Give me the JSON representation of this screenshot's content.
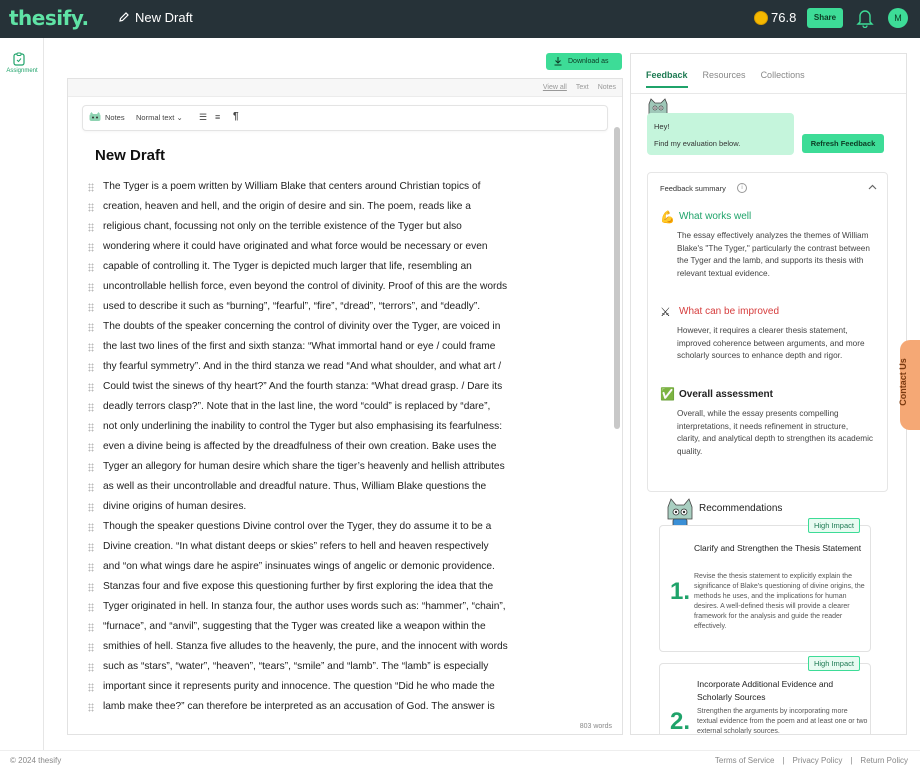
{
  "header": {
    "logo": "thesify.",
    "draft_title": "New Draft",
    "credits": "76.8",
    "share_label": "Share",
    "avatar_initial": "M"
  },
  "sidebar": {
    "assignment_label": "Assignment"
  },
  "editor": {
    "download_label": "Download as",
    "view_links": [
      "View all",
      "Text",
      "Notes"
    ],
    "toolbar": {
      "notes_label": "Notes",
      "style_label": "Normal text"
    },
    "doc_title": "New Draft",
    "lines": [
      "The Tyger is a poem written by William Blake that centers around Christian topics of",
      "creation, heaven and hell, and the origin of desire and sin. The poem, reads like a",
      "religious chant, focussing not only on the terrible existence of the Tyger but also",
      "wondering where it could have originated and what force would be necessary or even",
      "capable of controlling it. The Tyger is depicted much larger that life, resembling an",
      "uncontrollable hellish force, even beyond the control of divinity. Proof of this are the words",
      "used to describe it such as “burning”, “fearful”, “fire”, “dread”, “terrors”, and “deadly”.",
      "The doubts of the speaker concerning the control of divinity over the Tyger, are voiced in",
      "the last two lines of the first and sixth stanza: “What immortal hand or eye / could frame",
      "thy fearful symmetry”. And in the third stanza we read “And what shoulder, and what art /",
      "Could twist the sinews of thy heart?” And the fourth stanza: “What dread grasp. / Dare its",
      "deadly terrors clasp?”. Note that in the last line, the word “could” is replaced by “dare”,",
      "not only underlining the inability to control the Tyger but also emphasising its fearfulness:",
      "even a divine being is affected by the dreadfulness of their own creation. Bake uses the",
      "Tyger an allegory for human desire which share the tiger’s heavenly and hellish attributes",
      "as well as their uncontrollable and dreadful nature. Thus, William Blake questions the",
      "divine origins of human desires.",
      "Though the speaker questions Divine control over the Tyger, they do assume it to be a",
      "Divine creation. “In what distant deeps or skies” refers to hell and heaven respectively",
      "and “on what wings dare he aspire” insinuates wings of angelic or demonic providence.",
      "Stanzas four and five expose this questioning further by first exploring the idea that the",
      "Tyger originated in hell. In stanza four, the author uses words such as: “hammer”, “chain”,",
      "“furnace”, and “anvil”, suggesting that the Tyger was created like a weapon within the",
      "smithies of hell. Stanza five alludes to the heavenly, the pure, and the innocent with words",
      "such as “stars”, “water”, “heaven”, “tears”, “smile” and “lamb”. The “lamb” is especially",
      "important since it represents purity and innocence. The question “Did he who made the",
      "lamb make thee?” can therefore be interpreted as an accusation of God. The answer is"
    ],
    "word_count": "803 words"
  },
  "panel": {
    "tabs": [
      "Feedback",
      "Resources",
      "Collections"
    ],
    "greeting": "Hey!",
    "greeting_sub": "Find my evaluation below.",
    "refresh_label": "Refresh Feedback",
    "summary": {
      "heading": "Feedback summary",
      "sections": [
        {
          "icon": "💪",
          "title": "What works well",
          "color": "#1fa36a",
          "body": "The essay effectively analyzes the themes of William Blake's \"The Tyger,\" particularly the contrast between the Tyger and the lamb, and supports its thesis with relevant textual evidence."
        },
        {
          "icon": "⚔",
          "title": "What can be improved",
          "color": "#d63c3c",
          "body": "However, it requires a clearer thesis statement, improved coherence between arguments, and more scholarly sources to enhance depth and rigor."
        },
        {
          "icon": "✅",
          "title": "Overall assessment",
          "color": "#222222",
          "body": "Overall, while the essay presents compelling interpretations, it needs refinement in structure, clarity, and analytical depth to strengthen its academic quality."
        }
      ]
    },
    "recommendations": {
      "heading": "Recommendations",
      "items": [
        {
          "badge": "High Impact",
          "num": "1.",
          "title": "Clarify and Strengthen the Thesis Statement",
          "text": "Revise the thesis statement to explicitly explain the significance of Blake's questioning of divine origins, the methods he uses, and the implications for human desires. A well-defined thesis will provide a clearer framework for the analysis and guide the reader effectively."
        },
        {
          "badge": "High Impact",
          "num": "2.",
          "title": "Incorporate Additional Evidence and Scholarly Sources",
          "text": "Strengthen the arguments by incorporating more textual evidence from the poem and at least one or two external scholarly sources."
        }
      ]
    }
  },
  "contact_label": "Contact Us",
  "footer": {
    "copyright": "© 2024 thesify",
    "links": [
      "Terms of Service",
      "|",
      "Privacy Policy",
      "|",
      "Return Policy"
    ]
  },
  "colors": {
    "topbar": "#263238",
    "accent": "#3ddc97",
    "accent_dark": "#1fa36a",
    "contact": "#f5a875"
  }
}
